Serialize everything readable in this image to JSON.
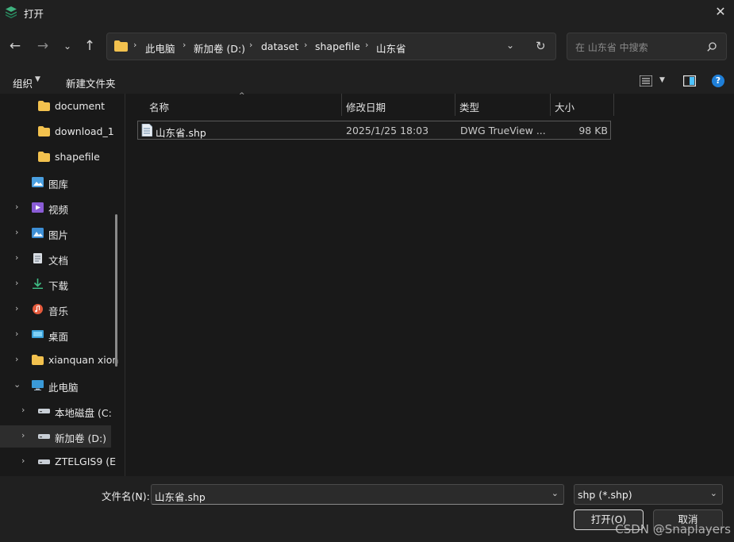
{
  "window": {
    "title": "打开"
  },
  "address": {
    "crumbs": [
      "此电脑",
      "新加卷 (D:)",
      "dataset",
      "shapefile",
      "山东省"
    ]
  },
  "search": {
    "placeholder": "在 山东省 中搜索"
  },
  "toolbar": {
    "organize_label": "组织",
    "new_folder_label": "新建文件夹"
  },
  "sidebar": {
    "items": [
      {
        "label": "document",
        "icon": "folder-icon",
        "expandable": false
      },
      {
        "label": "download_1",
        "icon": "folder-icon",
        "expandable": false
      },
      {
        "label": "shapefile",
        "icon": "folder-icon",
        "expandable": false
      },
      {
        "label": "图库",
        "icon": "gallery-icon",
        "expandable": false
      },
      {
        "label": "视频",
        "icon": "video-icon",
        "expandable": true
      },
      {
        "label": "图片",
        "icon": "pictures-icon",
        "expandable": true
      },
      {
        "label": "文档",
        "icon": "documents-icon",
        "expandable": true
      },
      {
        "label": "下载",
        "icon": "download-icon",
        "expandable": true
      },
      {
        "label": "音乐",
        "icon": "music-icon",
        "expandable": true
      },
      {
        "label": "桌面",
        "icon": "desktop-icon",
        "expandable": true
      },
      {
        "label": "xianquan xion",
        "icon": "folder-icon",
        "expandable": true
      },
      {
        "label": "此电脑",
        "icon": "computer-icon",
        "expandable": true,
        "expanded": true
      },
      {
        "label": "本地磁盘 (C:",
        "icon": "drive-icon",
        "expandable": true
      },
      {
        "label": "新加卷 (D:)",
        "icon": "drive-icon",
        "expandable": true,
        "selected": true
      },
      {
        "label": "ZTELGIS9 (E",
        "icon": "drive-icon",
        "expandable": true
      }
    ]
  },
  "file_list": {
    "columns": [
      "名称",
      "修改日期",
      "类型",
      "大小"
    ],
    "rows": [
      {
        "name": "山东省.shp",
        "modified": "2025/1/25 18:03",
        "type": "DWG TrueView ...",
        "size": "98 KB"
      }
    ]
  },
  "footer": {
    "filename_label": "文件名(N):",
    "filename_value": "山东省.shp",
    "filetype_value": "shp (*.shp)",
    "open_label": "打开(O)",
    "cancel_label": "取消"
  },
  "watermark": "CSDN @Snaplayers",
  "colors": {
    "background": "#191919",
    "chrome": "#202020",
    "folder": "#f2c14e",
    "accent": "#4cc2ff"
  }
}
